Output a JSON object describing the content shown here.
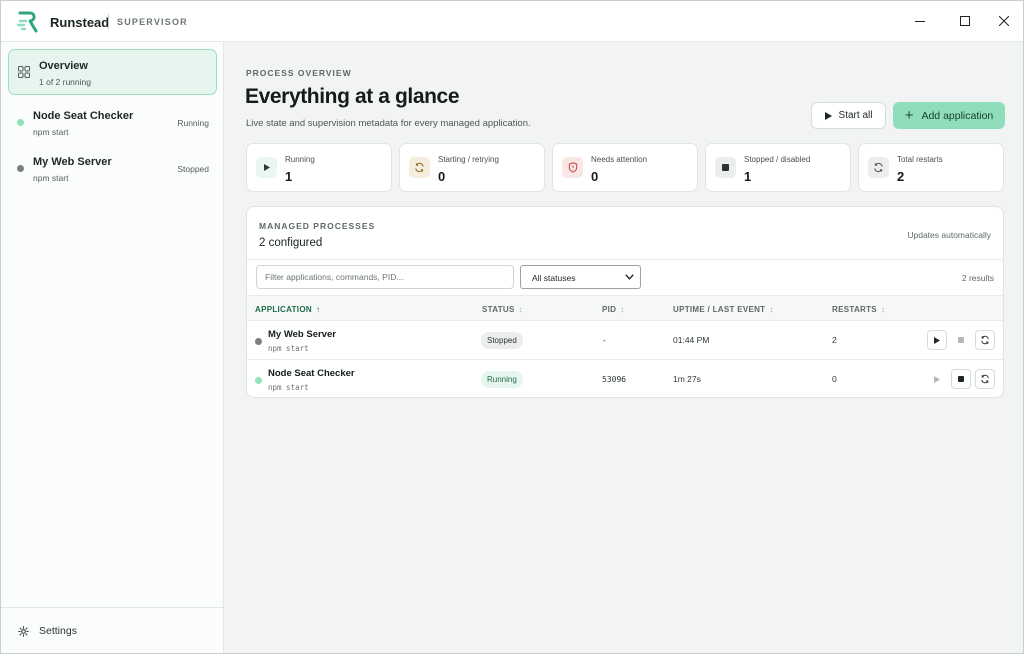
{
  "titlebar": {
    "app_name": "Runstead",
    "subtitle": "SUPERVISOR",
    "icons": [
      "minimize-icon",
      "maximize-icon",
      "close-icon"
    ]
  },
  "sidebar": {
    "overview": {
      "label": "Overview",
      "sub": "1 of 2 running",
      "icon": "grid-icon"
    },
    "processes": [
      {
        "name": "Node Seat Checker",
        "command": "npm start",
        "status": "Running",
        "dot_color": "#8fe3bd"
      },
      {
        "name": "My Web Server",
        "command": "npm start",
        "status": "Stopped",
        "dot_color": "#7a7f7d"
      }
    ],
    "settings_label": "Settings"
  },
  "main": {
    "eyebrow": "PROCESS OVERVIEW",
    "title": "Everything at a glance",
    "subtitle": "Live state and supervision metadata for every managed application.",
    "start_all_label": "Start all",
    "add_app_label": "Add application"
  },
  "stats": [
    {
      "label": "Running",
      "value": "1",
      "icon": "play-icon"
    },
    {
      "label": "Starting / retrying",
      "value": "0",
      "icon": "refresh-icon"
    },
    {
      "label": "Needs attention",
      "value": "0",
      "icon": "shield-alert-icon"
    },
    {
      "label": "Stopped / disabled",
      "value": "1",
      "icon": "stop-icon"
    },
    {
      "label": "Total restarts",
      "value": "2",
      "icon": "restart-icon"
    }
  ],
  "panel": {
    "eyebrow": "MANAGED PROCESSES",
    "title": "2 configured",
    "auto_update": "Updates automatically",
    "filter_placeholder": "Filter applications, commands, PID...",
    "status_filter": "All statuses",
    "results": "2 results",
    "columns": [
      "APPLICATION",
      "STATUS",
      "PID",
      "UPTIME / LAST EVENT",
      "RESTARTS"
    ],
    "sort_active": "↑",
    "sort_idle": "↕",
    "rows": [
      {
        "name": "My Web Server",
        "command": "npm start",
        "status": "Stopped",
        "pid": "-",
        "uptime": "01:44 PM",
        "restarts": "2",
        "dot_color": "#7a7f7d"
      },
      {
        "name": "Node Seat Checker",
        "command": "npm start",
        "status": "Running",
        "pid": "53096",
        "uptime": "1m 27s",
        "restarts": "0",
        "dot_color": "#8fe3bd"
      }
    ]
  },
  "colors": {
    "accent": "#8fddbb",
    "running": "#8fe3bd",
    "stopped": "#7a7f7d"
  }
}
